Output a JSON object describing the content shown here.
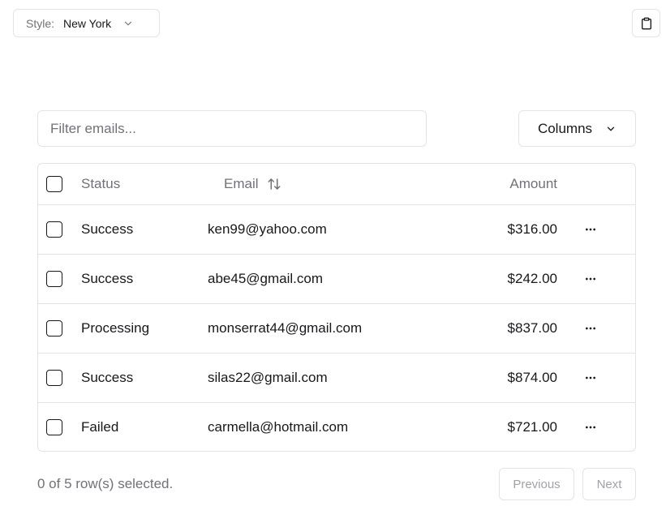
{
  "style_select": {
    "label": "Style:",
    "value": "New York"
  },
  "filter": {
    "placeholder": "Filter emails..."
  },
  "columns_button": {
    "label": "Columns"
  },
  "table": {
    "headers": {
      "status": "Status",
      "email": "Email",
      "amount": "Amount"
    },
    "rows": [
      {
        "status": "Success",
        "email": "ken99@yahoo.com",
        "amount": "$316.00"
      },
      {
        "status": "Success",
        "email": "abe45@gmail.com",
        "amount": "$242.00"
      },
      {
        "status": "Processing",
        "email": "monserrat44@gmail.com",
        "amount": "$837.00"
      },
      {
        "status": "Success",
        "email": "silas22@gmail.com",
        "amount": "$874.00"
      },
      {
        "status": "Failed",
        "email": "carmella@hotmail.com",
        "amount": "$721.00"
      }
    ]
  },
  "footer": {
    "selection_text": "0 of 5 row(s) selected.",
    "previous_label": "Previous",
    "next_label": "Next"
  },
  "icons": {
    "style_chevron": "chevron-down-icon",
    "copy": "clipboard-icon",
    "columns_chevron": "chevron-down-icon",
    "sort": "arrow-up-down-icon",
    "row_actions": "more-horizontal-icon"
  }
}
